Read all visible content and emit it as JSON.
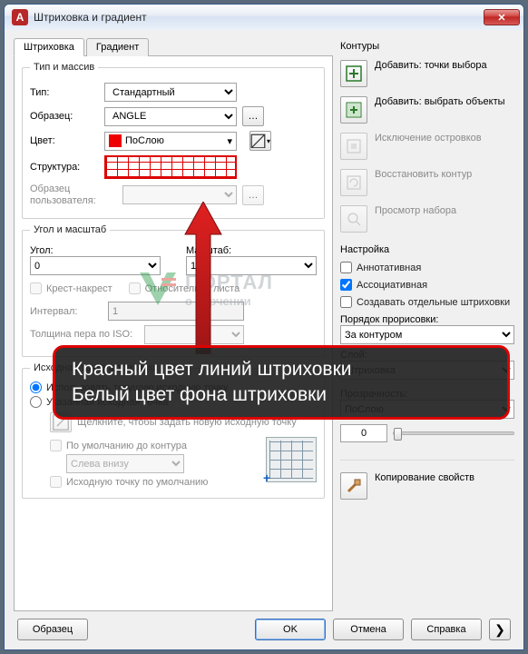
{
  "window": {
    "title": "Штриховка и градиент",
    "app_icon_letter": "A"
  },
  "tabs": {
    "hatch": "Штриховка",
    "gradient": "Градиент"
  },
  "type_section": {
    "legend": "Тип и массив",
    "type_label": "Тип:",
    "type_value": "Стандартный",
    "pattern_label": "Образец:",
    "pattern_value": "ANGLE",
    "color_label": "Цвет:",
    "color_value": "ПоСлою",
    "structure_label": "Структура:",
    "custom_label": "Образец пользователя:"
  },
  "angle_section": {
    "legend": "Угол и масштаб",
    "angle_label": "Угол:",
    "angle_value": "0",
    "scale_label": "Масштаб:",
    "scale_value": "1",
    "crisscross": "Крест-накрест",
    "relative_paper": "Относительно листа",
    "interval_label": "Интервал:",
    "interval_value": "1",
    "iso_label": "Толщина пера по ISO:"
  },
  "origin_section": {
    "legend": "Исходная точка штриховки",
    "use_current": "Использовать текущую исходную точку",
    "specified": "Указанная исходная точка",
    "click_new": "Щелкните, чтобы задать новую исходную точку",
    "default_boundary": "По умолчанию до контура",
    "position_value": "Слева внизу",
    "default_origin": "Исходную точку по умолчанию"
  },
  "boundaries": {
    "head": "Контуры",
    "add_pick": "Добавить: точки выбора",
    "add_select": "Добавить: выбрать объекты",
    "remove_islands": "Исключение островков",
    "recreate": "Восстановить контур",
    "view_sel": "Просмотр набора"
  },
  "options": {
    "head": "Настройка",
    "annotative": "Аннотативная",
    "associative": "Ассоциативная",
    "separate": "Создавать отдельные штриховки",
    "draw_order": "Порядок прорисовки:",
    "draw_order_value": "За контуром",
    "layer": "Слой:",
    "layer_value": "Штриховка"
  },
  "transparency": {
    "label": "Прозрачность:",
    "mode": "ПоСлою",
    "value": "0"
  },
  "inherit": "Копирование свойств",
  "buttons": {
    "preview": "Образец",
    "ok": "OK",
    "cancel": "Отмена",
    "help": "Справка"
  },
  "annotation": {
    "line1": "Красный цвет линий штриховки",
    "line2": "Белый цвет фона штриховки"
  },
  "watermark": {
    "line1": "ПОРТАЛ",
    "line2": "о черчении"
  }
}
